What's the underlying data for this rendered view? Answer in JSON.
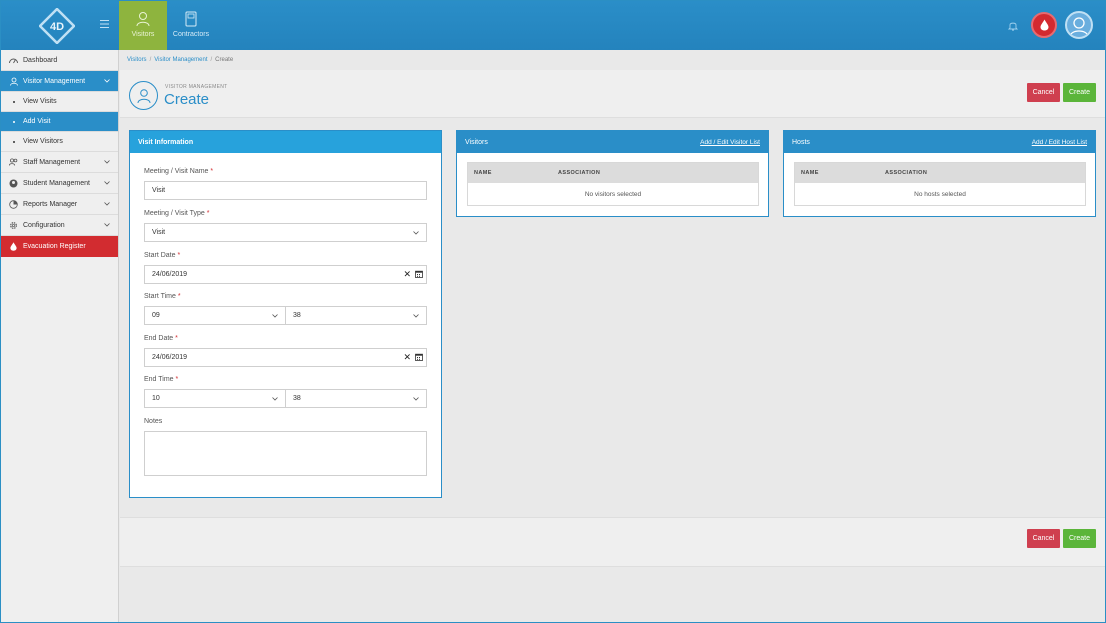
{
  "brand": {
    "logo_text": "4D"
  },
  "top_nav": [
    {
      "label": "Visitors",
      "icon": "person-icon",
      "active": true
    },
    {
      "label": "Contractors",
      "icon": "document-icon",
      "active": false
    }
  ],
  "sidebar": {
    "items": [
      {
        "label": "Dashboard",
        "icon": "dashboard-icon"
      },
      {
        "label": "Visitor Management",
        "icon": "person-icon",
        "expanded": true
      },
      {
        "label": "View Visits"
      },
      {
        "label": "Add Visit"
      },
      {
        "label": "View Visitors"
      },
      {
        "label": "Staff Management",
        "icon": "group-icon"
      },
      {
        "label": "Student Management",
        "icon": "student-icon"
      },
      {
        "label": "Reports Manager",
        "icon": "report-icon"
      },
      {
        "label": "Configuration",
        "icon": "gear-icon"
      },
      {
        "label": "Evacuation Register",
        "icon": "drop-icon"
      }
    ]
  },
  "breadcrumb": {
    "items": [
      "Visitors",
      "Visitor Management",
      "Create"
    ]
  },
  "page": {
    "subtitle": "VISITOR MANAGEMENT",
    "title": "Create"
  },
  "actions": {
    "cancel": "Cancel",
    "create": "Create"
  },
  "visit_info": {
    "title": "Visit Information",
    "name_label": "Meeting / Visit Name",
    "name_value": "Visit",
    "type_label": "Meeting / Visit Type",
    "type_value": "Visit",
    "start_date_label": "Start Date",
    "start_date_value": "24/06/2019",
    "start_time_label": "Start Time",
    "start_hour": "09",
    "start_minute": "38",
    "end_date_label": "End Date",
    "end_date_value": "24/06/2019",
    "end_time_label": "End Time",
    "end_hour": "10",
    "end_minute": "38",
    "notes_label": "Notes",
    "required_mark": "*"
  },
  "visitors_panel": {
    "title": "Visitors",
    "link": "Add / Edit Visitor List",
    "columns": [
      "NAME",
      "ASSOCIATION"
    ],
    "empty": "No visitors selected"
  },
  "hosts_panel": {
    "title": "Hosts",
    "link": "Add / Edit Host List",
    "columns": [
      "NAME",
      "ASSOCIATION"
    ],
    "empty": "No hosts selected"
  },
  "colors": {
    "primary": "#2a8ec8",
    "active_tab": "#8eb43e",
    "danger": "#d22c30",
    "cancel": "#cf3f4f",
    "create": "#5bb53a"
  }
}
